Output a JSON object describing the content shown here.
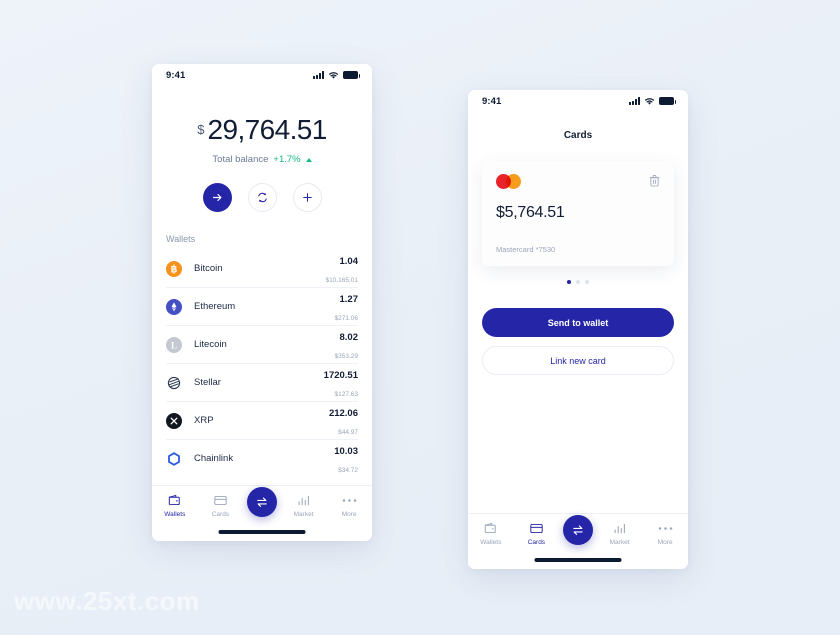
{
  "canvas": {
    "watermark": "www.25xt.com",
    "background": "#eaf0f8",
    "accent": "#2525a8"
  },
  "wallets_screen": {
    "status": {
      "time": "9:41",
      "signal_icon": "signal-bars-icon",
      "wifi_icon": "wifi-icon",
      "battery_icon": "battery-icon"
    },
    "balance": {
      "currency_symbol": "$",
      "amount": "29,764.51",
      "label": "Total balance",
      "change": "+1.7%",
      "change_direction_icon": "caret-up-icon",
      "change_color": "#17b97f"
    },
    "actions": [
      {
        "name": "send-button",
        "icon": "arrow-right-icon",
        "style": "primary"
      },
      {
        "name": "exchange-button",
        "icon": "refresh-swap-icon",
        "style": "ghost"
      },
      {
        "name": "add-button",
        "icon": "plus-icon",
        "style": "ghost"
      }
    ],
    "section_label": "Wallets",
    "wallets": [
      {
        "name": "Bitcoin",
        "amount": "1.04",
        "fiat": "$10,165.01",
        "icon": "bitcoin-icon",
        "color": "#f7931a",
        "glyph": "Ƀ"
      },
      {
        "name": "Ethereum",
        "amount": "1.27",
        "fiat": "$271.06",
        "icon": "ethereum-icon",
        "color": "#4550c4",
        "glyph": "♦"
      },
      {
        "name": "Litecoin",
        "amount": "8.02",
        "fiat": "$353.29",
        "icon": "litecoin-icon",
        "color": "#bfc4cc",
        "glyph": "Ł"
      },
      {
        "name": "Stellar",
        "amount": "1720.51",
        "fiat": "$127.63",
        "icon": "stellar-icon",
        "color": "#ffffff",
        "glyph": ""
      },
      {
        "name": "XRP",
        "amount": "212.06",
        "fiat": "$44.97",
        "icon": "xrp-icon",
        "color": "#11171f",
        "glyph": "✕"
      },
      {
        "name": "Chainlink",
        "amount": "10.03",
        "fiat": "$34.72",
        "icon": "chainlink-icon",
        "color": "#2a5ada",
        "glyph": ""
      }
    ],
    "tabs": [
      {
        "label": "Wallets",
        "icon": "wallet-icon",
        "active": true
      },
      {
        "label": "Cards",
        "icon": "card-icon",
        "active": false
      },
      {
        "label": "",
        "icon": "swap-icon",
        "active": false
      },
      {
        "label": "Market",
        "icon": "bar-chart-icon",
        "active": false
      },
      {
        "label": "More",
        "icon": "ellipsis-icon",
        "active": false
      }
    ]
  },
  "cards_screen": {
    "status": {
      "time": "9:41",
      "signal_icon": "signal-bars-icon",
      "wifi_icon": "wifi-icon",
      "battery_icon": "battery-icon"
    },
    "title": "Cards",
    "card": {
      "brand_icon": "mastercard-logo",
      "delete_icon": "trash-icon",
      "amount": "$5,764.51",
      "meta": "Mastercard *7530"
    },
    "pagination": {
      "count": 3,
      "active_index": 0
    },
    "primary_button": "Send to wallet",
    "secondary_button": "Link new card",
    "tabs": [
      {
        "label": "Wallets",
        "icon": "wallet-icon",
        "active": false
      },
      {
        "label": "Cards",
        "icon": "card-icon",
        "active": true
      },
      {
        "label": "",
        "icon": "swap-icon",
        "active": false
      },
      {
        "label": "Market",
        "icon": "bar-chart-icon",
        "active": false
      },
      {
        "label": "More",
        "icon": "ellipsis-icon",
        "active": false
      }
    ]
  }
}
